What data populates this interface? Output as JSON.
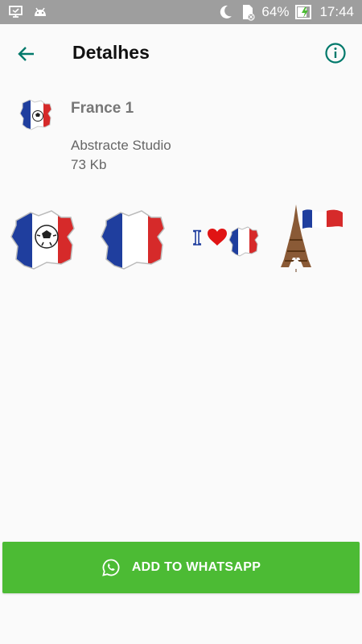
{
  "status_bar": {
    "battery_percent": "64%",
    "time": "17:44"
  },
  "toolbar": {
    "title": "Detalhes"
  },
  "pack": {
    "name": "France 1",
    "publisher": "Abstracte Studio",
    "size": "73 Kb"
  },
  "stickers": [
    {
      "icon": "france-map-soccer-ball-sticker"
    },
    {
      "icon": "france-map-flag-sticker"
    },
    {
      "icon": "i-love-france-sticker"
    },
    {
      "icon": "eiffel-tower-flag-sticker"
    }
  ],
  "actions": {
    "add_label": "ADD TO WHATSAPP"
  },
  "colors": {
    "accent": "#00796b",
    "button_green": "#4cbb34",
    "status_bar": "#9e9e9e",
    "flag_blue": "#1f3e9e",
    "flag_red": "#d62a2a"
  }
}
